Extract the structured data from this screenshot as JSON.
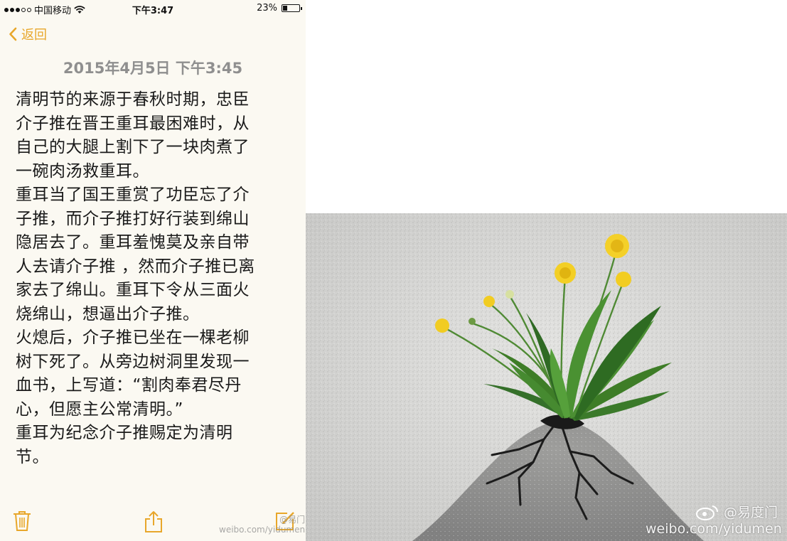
{
  "status_bar": {
    "carrier": "中国移动",
    "time": "下午3:47",
    "battery": "23%",
    "battery_level": 0.23
  },
  "nav": {
    "back_label": "返回"
  },
  "note": {
    "date": "2015年4月5日 下午3:45",
    "lines": [
      "清明节的来源于春秋时期，忠臣",
      "介子推在晋王重耳最困难时，从",
      "自己的大腿上割下了一块肉煮了",
      "一碗肉汤救重耳。",
      "重耳当了国王重赏了功臣忘了介",
      "子推，而介子推打好行装到绵山",
      "隐居去了。重耳羞愧莫及亲自带",
      "人去请介子推 ，然而介子推已离",
      "家去了绵山。重耳下令从三面火",
      "烧绵山，想逼出介子推。",
      "火熄后，介子推已坐在一棵老柳",
      "树下死了。从旁边树洞里发现一",
      "血书，上写道：“割肉奉君尽丹",
      "心，但愿主公常清明。”",
      "重耳为纪念介子推赐定为清明",
      "节。"
    ]
  },
  "toolbar": {
    "icons": [
      "trash-icon",
      "share-icon",
      "compose-icon"
    ]
  },
  "watermarks": {
    "left_handle": "@易门",
    "left_url": "weibo.com/yidumen",
    "right_handle": "@易度门",
    "right_url": "weibo.com/yidumen"
  },
  "colors": {
    "accent": "#e8a72b",
    "paper": "#fbf9f2",
    "date_gray": "#8f8f8f"
  }
}
